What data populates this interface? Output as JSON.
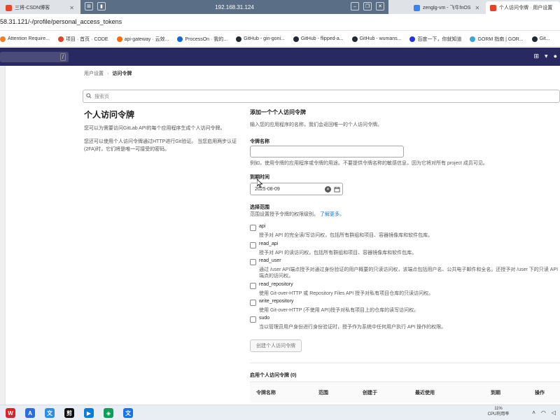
{
  "browser": {
    "tabs": [
      {
        "label": "三将-CSDN博客",
        "favicon_color": "#e8452c",
        "active": false
      },
      {
        "label": "zenglg-vm - 飞牛fnOS",
        "favicon_color": "#3b82f6",
        "active": false
      },
      {
        "label": "个人访问令牌 · 用户设置",
        "favicon_color": "#e24329",
        "active": true
      }
    ],
    "remote_host": "192.168.31.124",
    "address": "58.31.121/-/profile/personal_access_tokens",
    "bookmarks": [
      {
        "label": "Attention Require...",
        "color": "#f48120"
      },
      {
        "label": "项目 · 首页 · CODE",
        "color": "#e24329"
      },
      {
        "label": "api-gateway · 云效...",
        "color": "#ff6a00"
      },
      {
        "label": "ProcessOn · 我的...",
        "color": "#0f6ad8"
      },
      {
        "label": "GitHub - gin-goni...",
        "color": "#24292f"
      },
      {
        "label": "GitHub - flipped-a...",
        "color": "#24292f"
      },
      {
        "label": "GitHub - wumans...",
        "color": "#24292f"
      },
      {
        "label": "百度一下，你就知道",
        "color": "#2932e1"
      },
      {
        "label": "GORM 指南 | GOR...",
        "color": "#3aa6d8"
      },
      {
        "label": "Git...",
        "color": "#24292f"
      }
    ]
  },
  "navbar": {
    "search_shortcut": "/",
    "bg_color": "#292961"
  },
  "breadcrumb": {
    "parent": "用户设置",
    "current": "访问令牌"
  },
  "search": {
    "placeholder": "搜索页"
  },
  "intro": {
    "title": "个人访问令牌",
    "p1": "您可以为需要访问GitLab API的每个应用程序生成个人访问令牌。",
    "p2": "您还可以使用个人访问令牌通过HTTP进行Git验证。 当您启用两步认证(2FA)时，它们将是唯一可接受的密码。"
  },
  "form": {
    "section_title": "添加一个个人访问令牌",
    "section_help": "输入您的应用程序的名称，我们会返回唯一的个人访问令牌。",
    "name_label": "令牌名称",
    "name_help": "例如，使用令牌的应用程序或令牌的用途。不要提供令牌名称的敏感信息，因为它将对所有 project 成员可见。",
    "expiry_label": "到期时间",
    "expiry_value": "2025-08-09",
    "scopes_label": "选择范围",
    "scopes_help": "范围设置授予令牌的权限级别。",
    "scopes_link": "了解更多。",
    "scopes": [
      {
        "name": "api",
        "desc": "授予对 API 的完全读/写访问权，包括所有群组和项目、容器镜像库和软件包库。"
      },
      {
        "name": "read_api",
        "desc": "授予对 API 的读访问权，包括所有群组和项目、容器镜像库和软件包库。"
      },
      {
        "name": "read_user",
        "desc": "通过 /user API端点授予对通过身份验证的用户概要的只读访问权，该端点包括用户名、公共电子邮件和全名。还授予对 /user 下的只读 API 端点的访问权。"
      },
      {
        "name": "read_repository",
        "desc": "使用 Git-over-HTTP 或 Repository Files API 授予对私有项目仓库的只读访问权。"
      },
      {
        "name": "write_repository",
        "desc": "使用 Git-over-HTTP (不使用 API)授予对私有项目上的仓库的读写访问权。"
      },
      {
        "name": "sudo",
        "desc": "当以管理员用户身份进行身份验证时，授予作为系统中任何用户执行 API 操作的权限。"
      }
    ],
    "submit_label": "创建个人访问令牌"
  },
  "active_tokens": {
    "title": "启用个人访问令牌 (0)",
    "columns": [
      "令牌名称",
      "范围",
      "创建于",
      "最近使用",
      "到期",
      "操作"
    ]
  },
  "taskbar": {
    "apps": [
      {
        "label": "W",
        "color": "#d9232d"
      },
      {
        "label": "A",
        "color": "#2d6cdf"
      },
      {
        "label": "文",
        "color": "#2b8de6"
      },
      {
        "label": "剪",
        "color": "#111111"
      },
      {
        "label": "▶",
        "color": "#0a7cd9"
      },
      {
        "label": "◈",
        "color": "#0f9d58"
      },
      {
        "label": "文",
        "color": "#1a73e8"
      }
    ],
    "cpu_value": "11%",
    "cpu_label": "CPU利用率"
  }
}
